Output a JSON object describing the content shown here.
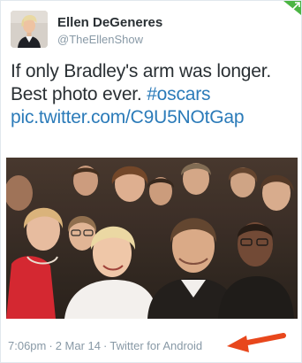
{
  "author": {
    "name": "Ellen DeGeneres",
    "handle": "@TheEllenShow"
  },
  "tweet": {
    "text_line1": "If only Bradley's arm was longer.",
    "text_line2_plain": "Best photo ever. ",
    "hashtag": "#oscars",
    "media_link": "pic.twitter.com/C9U5NOtGap"
  },
  "meta": {
    "time": "7:06pm",
    "separator": "·",
    "date": "2 Mar 14",
    "source": "Twitter for Android"
  },
  "colors": {
    "link": "#2b7bb9",
    "muted": "#8899a6",
    "text": "#292f33",
    "annotation_arrow": "#e8471c",
    "badge": "#4bb543"
  },
  "icons": {
    "corner_badge": "follow-arrow-icon",
    "annotation": "red-arrow-icon"
  }
}
